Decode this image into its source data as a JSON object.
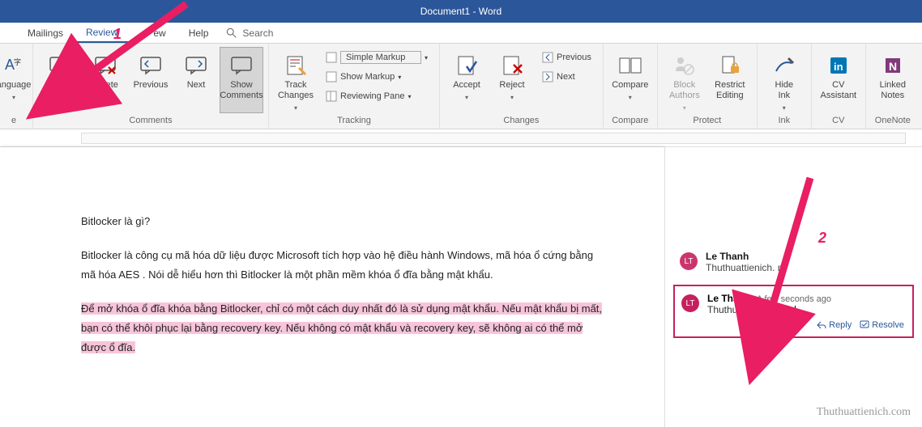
{
  "title": "Document1 - Word",
  "tabs": {
    "mailings": "Mailings",
    "review": "Review",
    "view": "ew",
    "help": "Help",
    "search": "Search"
  },
  "ribbon": {
    "language": "anguage",
    "new_comment": "New\nComment",
    "delete": "Delete",
    "previous": "Previous",
    "next": "Next",
    "show_comments": "Show\nComments",
    "track_changes": "Track\nChanges",
    "simple_markup": "Simple Markup",
    "show_markup": "Show Markup",
    "reviewing_pane": "Reviewing Pane",
    "accept": "Accept",
    "reject": "Reject",
    "changes_previous": "Previous",
    "changes_next": "Next",
    "compare": "Compare",
    "block_authors": "Block\nAuthors",
    "restrict_editing": "Restrict\nEditing",
    "hide_ink": "Hide\nInk",
    "cv_assistant": "CV\nAssistant",
    "linked_notes": "Linked\nNotes"
  },
  "groups": {
    "language_g": "e",
    "comments": "Comments",
    "tracking": "Tracking",
    "changes": "Changes",
    "compare": "Compare",
    "protect": "Protect",
    "ink": "Ink",
    "cv": "CV",
    "onenote": "OneNote"
  },
  "document": {
    "p1": "Bitlocker là gì?",
    "p2": "Bitlocker là công cụ mã hóa dữ liệu được Microsoft tích hợp vào hệ điều hành Windows, mã hóa ổ cứng bằng mã hóa AES . Nói dễ hiểu hơn thì Bitlocker là một phần mềm khóa ổ đĩa bằng mật khẩu.",
    "p3": "Để mở khóa ổ đĩa khóa bằng Bitlocker, chỉ có một cách duy nhất đó là sử dụng mật khẩu. Nếu mật khẩu bị mất, bạn có thể khôi phục lại bằng recovery key. Nếu không có mật khẩu và recovery key, sẽ không ai có thể mở được ổ đĩa."
  },
  "comments_pane": {
    "c1": {
      "initials": "LT",
      "author": "Le Thanh",
      "body": "Thuthuattienich.  m"
    },
    "c2": {
      "initials": "LT",
      "author": "Le Thanh",
      "time": "A few seconds ago",
      "body": "Thuthuattienich.com",
      "reply": "Reply",
      "resolve": "Resolve"
    }
  },
  "annotations": {
    "one": "1",
    "two": "2"
  },
  "watermark": "Thuthuattienich.com"
}
